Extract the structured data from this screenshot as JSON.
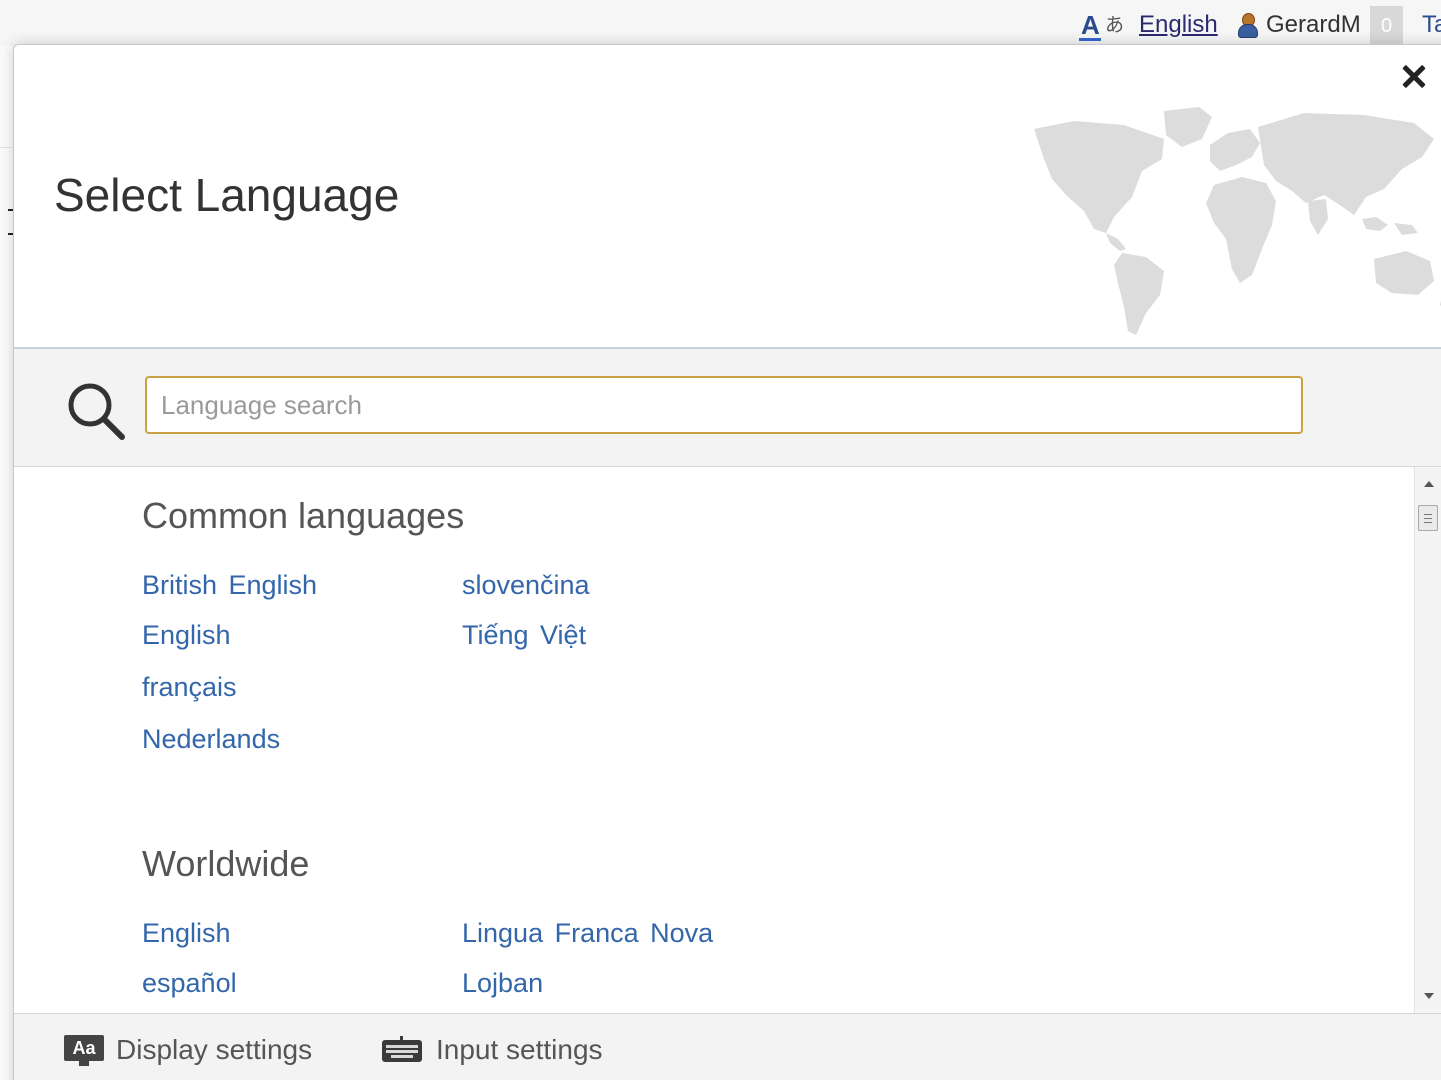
{
  "topbar": {
    "uls_trigger_label": "English",
    "username": "GerardM",
    "notification_count": "0",
    "cut_link": "Ta"
  },
  "icons": {
    "language": "language-aa-icon",
    "user": "user-icon",
    "close": "close-icon",
    "search": "search-icon",
    "display": "display-settings-icon",
    "keyboard": "keyboard-icon",
    "map": "world-map"
  },
  "dialog": {
    "title": "Select Language",
    "search": {
      "placeholder": "Language search",
      "value": ""
    },
    "common": {
      "title": "Common languages",
      "col1": [
        "British English",
        "English",
        "français",
        "Nederlands"
      ],
      "col2": [
        "slovenčina",
        "Tiếng Việt"
      ]
    },
    "worldwide": {
      "title": "Worldwide",
      "col1": [
        "English",
        "español"
      ],
      "col2": [
        "Lingua Franca Nova",
        "Lojban"
      ]
    },
    "footer": {
      "display_settings": "Display settings",
      "display_icon_text": "Aa",
      "input_settings": "Input settings"
    }
  },
  "colors": {
    "link": "#3366aa",
    "search_border": "#c9a243",
    "header_text": "#333333",
    "map": "#dcdcdc"
  }
}
